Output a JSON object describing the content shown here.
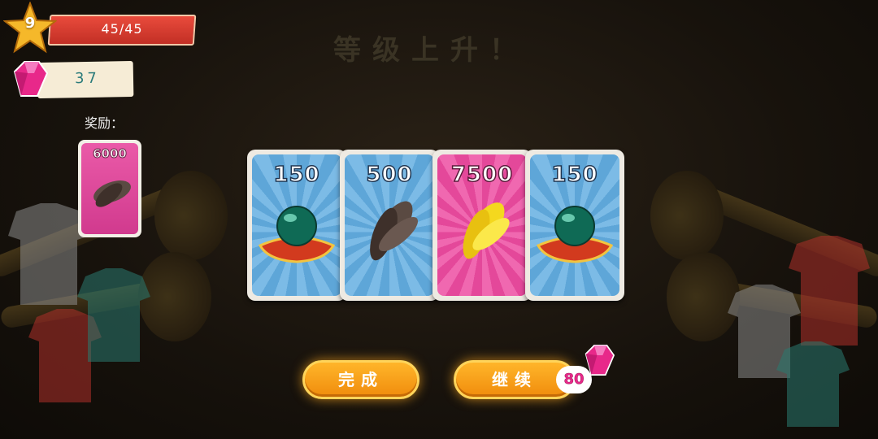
{
  "title": "等级上升！",
  "hud": {
    "level": "9",
    "xp_text": "45/45",
    "gems": "37"
  },
  "reward": {
    "label": "奖励：",
    "value": "6000"
  },
  "cards": [
    {
      "value": "150",
      "theme": "blue",
      "icon": "green-orb-on-cushion-icon"
    },
    {
      "value": "500",
      "theme": "blue",
      "icon": "dark-feather-icon"
    },
    {
      "value": "7500",
      "theme": "pink",
      "icon": "golden-feather-icon"
    },
    {
      "value": "150",
      "theme": "blue",
      "icon": "green-orb-on-cushion-icon"
    }
  ],
  "buttons": {
    "done": "完成",
    "continue": "继续",
    "continue_cost": "80"
  },
  "colors": {
    "card_blue": "#6aaee0",
    "card_pink": "#ea55a6",
    "button_orange": "#f5a01a",
    "gem_pink": "#e8288a",
    "xp_red": "#d63a2e"
  }
}
